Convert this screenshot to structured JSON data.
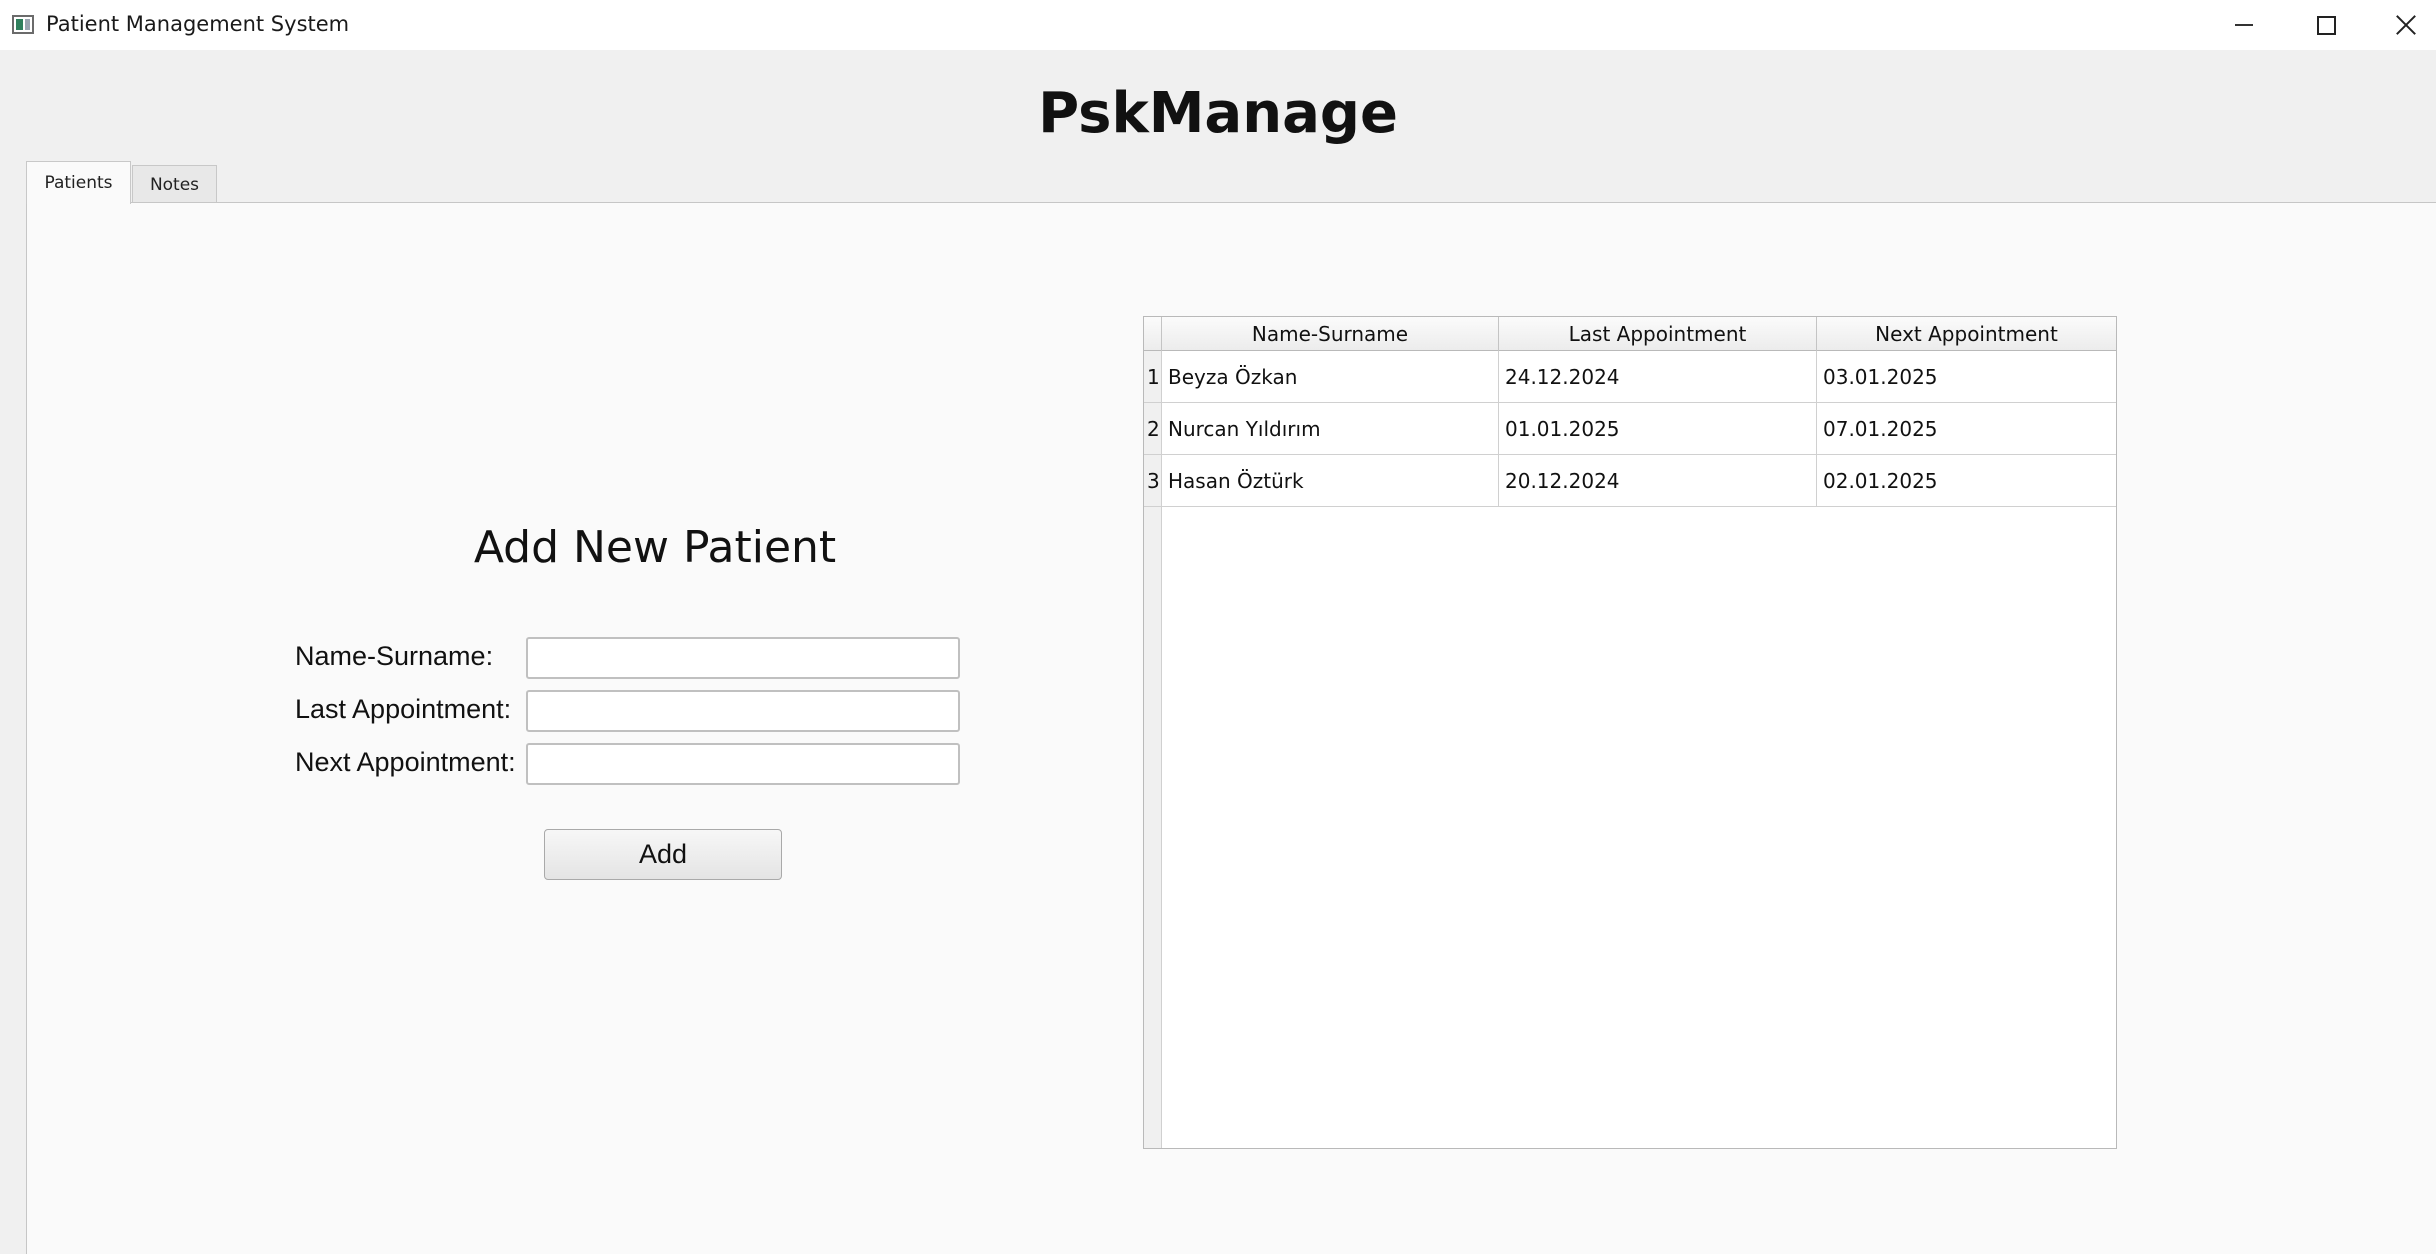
{
  "window": {
    "title": "Patient Management System"
  },
  "app": {
    "header": "PskManage"
  },
  "tabs": [
    {
      "label": "Patients",
      "selected": true
    },
    {
      "label": "Notes",
      "selected": false
    }
  ],
  "form": {
    "title": "Add New Patient",
    "fields": [
      {
        "label": "Name-Surname:",
        "value": ""
      },
      {
        "label": "Last Appointment:",
        "value": ""
      },
      {
        "label": "Next Appointment:",
        "value": ""
      }
    ],
    "submit_label": "Add"
  },
  "table": {
    "columns": [
      "Name-Surname",
      "Last Appointment",
      "Next Appointment"
    ],
    "rows": [
      {
        "index": "1",
        "name": "Beyza Özkan",
        "last": "24.12.2024",
        "next": "03.01.2025"
      },
      {
        "index": "2",
        "name": "Nurcan Yıldırım",
        "last": "01.01.2025",
        "next": "07.01.2025"
      },
      {
        "index": "3",
        "name": "Hasan Öztürk",
        "last": "20.12.2024",
        "next": "02.01.2025"
      }
    ]
  },
  "icons": {
    "app": "app-window-icon",
    "minimize": "minimize-icon",
    "maximize": "maximize-icon",
    "close": "close-icon"
  }
}
